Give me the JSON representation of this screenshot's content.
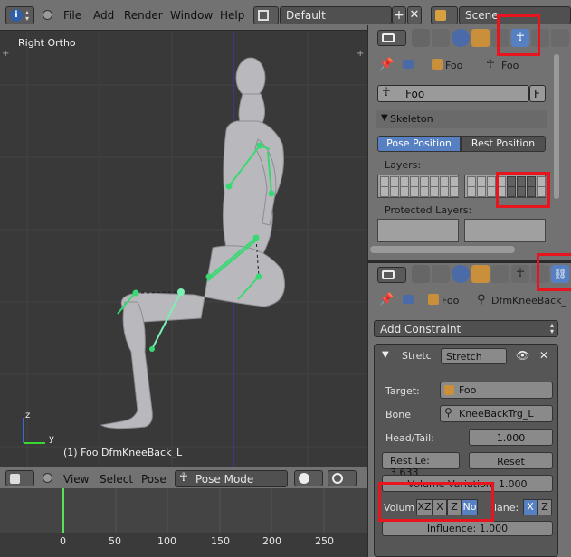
{
  "menu": {
    "items": [
      "File",
      "Add",
      "Render",
      "Window",
      "Help"
    ],
    "layout": "Default",
    "scene": "Scene"
  },
  "viewport": {
    "view_name": "Right Ortho",
    "status": "(1) Foo DfmKneeBack_L",
    "axis_z": "z",
    "axis_y": "y"
  },
  "armature_panel": {
    "breadcrumb_object": "Foo",
    "breadcrumb_data": "Foo",
    "datablock_name": "Foo",
    "fake_user": "F",
    "section_title": "Skeleton",
    "pose_position": "Pose Position",
    "rest_position": "Rest Position",
    "layers_label": "Layers:",
    "protected_layers_label": "Protected Layers:"
  },
  "constraint_panel": {
    "breadcrumb_object": "Foo",
    "breadcrumb_bone": "DfmKneeBack_",
    "add_constraint": "Add Constraint",
    "constraint_type_short": "Stretc",
    "constraint_name": "Stretch",
    "target_label": "Target:",
    "target_value": "Foo",
    "bone_label": "Bone",
    "bone_value": "KneeBackTrg_L",
    "head_tail_label": "Head/Tail:",
    "head_tail_value": "1.000",
    "rest_length": "Rest Le: 3.633",
    "reset_label": "Reset",
    "volume_variation": "Volume Variation: 1.000",
    "volume_label": "Volum",
    "volume_options": [
      "XZ",
      "X",
      "Z",
      "No"
    ],
    "volume_selected": "No",
    "plane_label": "lane:",
    "plane_options": [
      "X",
      "Z"
    ],
    "plane_selected": "X",
    "influence": "Influence: 1.000"
  },
  "timeline": {
    "menu": [
      "View",
      "Select",
      "Pose"
    ],
    "mode": "Pose Mode",
    "ruler": [
      "0",
      "50",
      "100",
      "150",
      "200",
      "250"
    ],
    "current_frame": "1"
  },
  "colors": {
    "accent_blue": "#5680c2",
    "highlight_red": "#e8141e",
    "bone_green": "#3ad873"
  }
}
